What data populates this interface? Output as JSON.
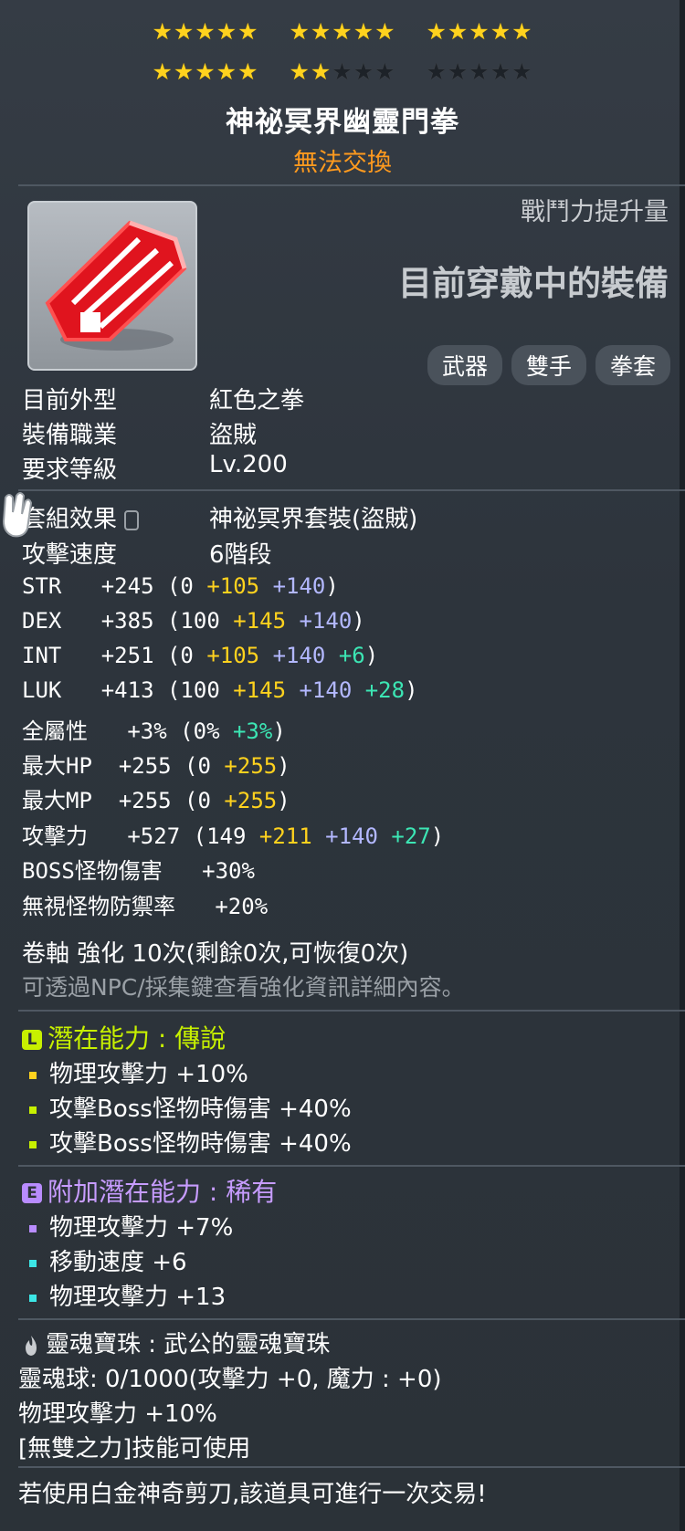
{
  "stars": {
    "row1": [
      5,
      5,
      5
    ],
    "row2_filled": [
      5,
      2,
      0
    ],
    "per_group": 5
  },
  "item": {
    "name": "神祕冥界幽靈門拳",
    "trade": "無法交換",
    "combat_power_label": "戰鬥力提升量",
    "equipped_label": "目前穿戴中的裝備",
    "tags": [
      "武器",
      "雙手",
      "拳套"
    ],
    "icon": "red-claw-icon"
  },
  "info": [
    {
      "label": "目前外型",
      "value": "紅色之拳"
    },
    {
      "label": "裝備職業",
      "value": "盜賊"
    },
    {
      "label": "要求等級",
      "value": "Lv.200"
    }
  ],
  "set": {
    "label": "套組效果",
    "value": "神祕冥界套裝(盜賊)",
    "icon": "lock-icon"
  },
  "speed": {
    "label": "攻擊速度",
    "value": "6階段"
  },
  "stats": [
    {
      "name": "STR",
      "total": "+245",
      "base": "0",
      "scroll": "+105",
      "flame": "+140",
      "star": ""
    },
    {
      "name": "DEX",
      "total": "+385",
      "base": "100",
      "scroll": "+145",
      "flame": "+140",
      "star": ""
    },
    {
      "name": "INT",
      "total": "+251",
      "base": "0",
      "scroll": "+105",
      "flame": "+140",
      "star": "+6"
    },
    {
      "name": "LUK",
      "total": "+413",
      "base": "100",
      "scroll": "+145",
      "flame": "+140",
      "star": "+28"
    }
  ],
  "allstat": {
    "name": "全屬性",
    "total": "+3%",
    "base": "0%",
    "extra": "+3%"
  },
  "hp": {
    "name": "最大HP",
    "total": "+255",
    "base": "0",
    "scroll": "+255"
  },
  "mp": {
    "name": "最大MP",
    "total": "+255",
    "base": "0",
    "scroll": "+255"
  },
  "atk": {
    "name": "攻擊力",
    "total": "+527",
    "base": "149",
    "scroll": "+211",
    "flame": "+140",
    "star": "+27"
  },
  "boss": {
    "name": "BOSS怪物傷害",
    "value": "+30%"
  },
  "ignore": {
    "name": "無視怪物防禦率",
    "value": "+20%"
  },
  "upgrade": {
    "line": "卷軸 強化 10次(剩餘0次,可恢復0次)",
    "note": "可透過NPC/採集鍵查看強化資訊詳細內容。"
  },
  "potential": {
    "badge": "L",
    "title": "潛在能力 : 傳說",
    "lines": [
      "物理攻擊力 +10%",
      "攻擊Boss怪物時傷害 +40%",
      "攻擊Boss怪物時傷害 +40%"
    ],
    "colors": {
      "badge": "#c7f000",
      "title": "#c7f000",
      "bullet": "#ffd21e",
      "bullet2": "#c7f000"
    }
  },
  "bonus": {
    "badge": "E",
    "title": "附加潛在能力 : 稀有",
    "lines": [
      "物理攻擊力 +7%",
      "移動速度 +6",
      "物理攻擊力 +13"
    ],
    "colors": {
      "badge": "#b98cff",
      "title": "#c79cff",
      "bullet": "#b98cff",
      "bullet2": "#3ce6e6"
    }
  },
  "soul": {
    "title": "靈魂寶珠 : 武公的靈魂寶珠",
    "charge": "靈魂球: 0/1000(攻擊力 +0, 魔力 : +0)",
    "effect": "物理攻擊力 +10%",
    "skill": "[無雙之力]技能可使用"
  },
  "footer": "若使用白金神奇剪刀,該道具可進行一次交易!"
}
